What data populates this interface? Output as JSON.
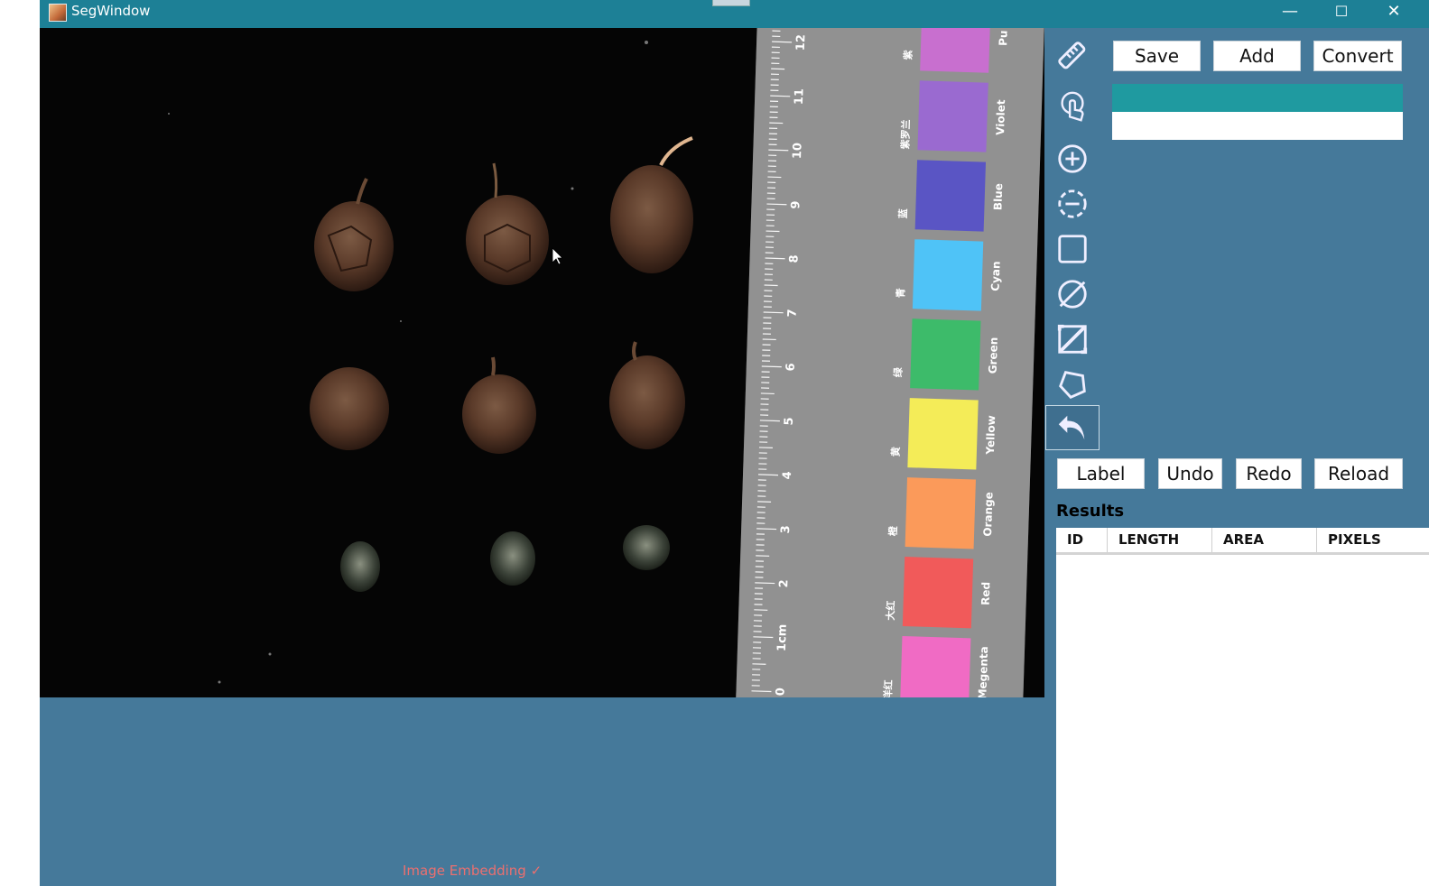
{
  "window": {
    "title": "SegWindow",
    "controls": [
      "—",
      "☐",
      "✕"
    ]
  },
  "toolbar": {
    "save_label": "Save",
    "add_label": "Add",
    "convert_label": "Convert",
    "label_label": "Label",
    "undo_label": "Undo",
    "redo_label": "Redo",
    "reload_label": "Reload"
  },
  "tools": [
    {
      "name": "ruler-icon"
    },
    {
      "name": "hand-pointer-icon"
    },
    {
      "name": "add-point-icon"
    },
    {
      "name": "remove-point-icon"
    },
    {
      "name": "rectangle-icon"
    },
    {
      "name": "no-select-icon"
    },
    {
      "name": "crop-edit-icon"
    },
    {
      "name": "polygon-icon"
    },
    {
      "name": "undo-arrow-icon"
    }
  ],
  "results": {
    "title": "Results",
    "columns": [
      "ID",
      "LENGTH",
      "AREA",
      "PIXELS"
    ]
  },
  "status": {
    "embedding": "Image Embedding ✓"
  },
  "image": {
    "ruler_numbers": [
      "12",
      "11",
      "10",
      "9",
      "8",
      "7",
      "6",
      "5",
      "4",
      "3",
      "2",
      "1cm",
      "0"
    ],
    "swatches": [
      {
        "color": "#c86fcf",
        "en": "Pu",
        "zh": "紫"
      },
      {
        "color": "#9a6ad0",
        "en": "Violet",
        "zh": "紫罗兰"
      },
      {
        "color": "#5a55c4",
        "en": "Blue",
        "zh": "蓝"
      },
      {
        "color": "#4fc3f7",
        "en": "Cyan",
        "zh": "青"
      },
      {
        "color": "#3dbb6a",
        "en": "Green",
        "zh": "绿"
      },
      {
        "color": "#f4ec58",
        "en": "Yellow",
        "zh": "黄"
      },
      {
        "color": "#fb9a5a",
        "en": "Orange",
        "zh": "橙"
      },
      {
        "color": "#f15a5a",
        "en": "Red",
        "zh": "大红"
      },
      {
        "color": "#f06bc4",
        "en": "Megenta",
        "zh": "洋红"
      }
    ]
  }
}
